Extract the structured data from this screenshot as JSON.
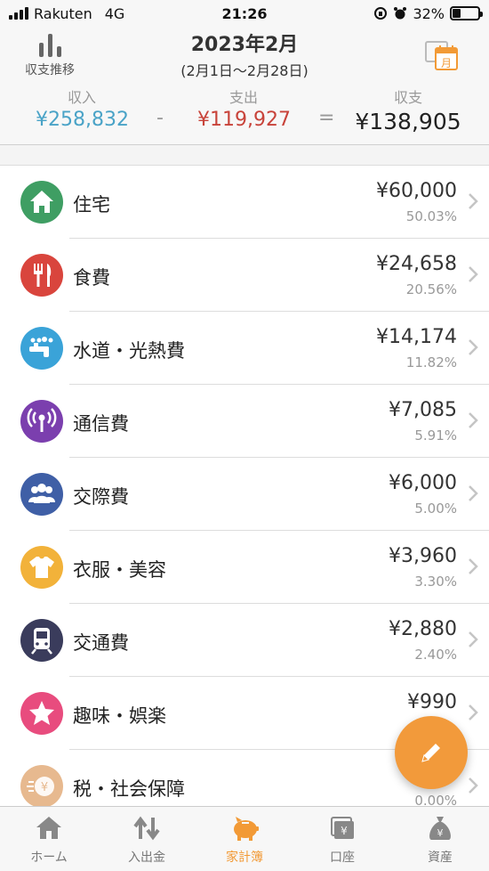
{
  "status": {
    "carrier": "Rakuten",
    "network": "4G",
    "time": "21:26",
    "battery": "32%"
  },
  "header": {
    "trend_label": "収支推移",
    "month_title": "2023年2月",
    "date_range": "(2月1日〜2月28日)",
    "calendar_badge": "月"
  },
  "summary": {
    "income_label": "収入",
    "income_value": "¥258,832",
    "expense_label": "支出",
    "expense_value": "¥119,927",
    "balance_label": "収支",
    "balance_value": "¥138,905",
    "minus": "-",
    "equals": "=",
    "colors": {
      "income": "#4aa3c7",
      "expense": "#c8433a"
    }
  },
  "categories": [
    {
      "name": "住宅",
      "amount": "¥60,000",
      "percent": "50.03%",
      "color": "#3f9e63",
      "icon": "house-icon"
    },
    {
      "name": "食費",
      "amount": "¥24,658",
      "percent": "20.56%",
      "color": "#d9453d",
      "icon": "fork-knife-icon"
    },
    {
      "name": "水道・光熱費",
      "amount": "¥14,174",
      "percent": "11.82%",
      "color": "#3aa3d8",
      "icon": "faucet-icon"
    },
    {
      "name": "通信費",
      "amount": "¥7,085",
      "percent": "5.91%",
      "color": "#7b3fae",
      "icon": "antenna-icon"
    },
    {
      "name": "交際費",
      "amount": "¥6,000",
      "percent": "5.00%",
      "color": "#3f5fa6",
      "icon": "people-icon"
    },
    {
      "name": "衣服・美容",
      "amount": "¥3,960",
      "percent": "3.30%",
      "color": "#f2b23a",
      "icon": "tshirt-icon"
    },
    {
      "name": "交通費",
      "amount": "¥2,880",
      "percent": "2.40%",
      "color": "#3a3c5c",
      "icon": "train-icon"
    },
    {
      "name": "趣味・娯楽",
      "amount": "¥990",
      "percent": "",
      "color": "#e84c7e",
      "icon": "star-icon"
    },
    {
      "name": "税・社会保障",
      "amount": "",
      "percent": "0.00%",
      "color": "#e7b98f",
      "icon": "coin-icon"
    }
  ],
  "tabs": [
    {
      "label": "ホーム",
      "icon": "home-icon",
      "active": false
    },
    {
      "label": "入出金",
      "icon": "transfer-icon",
      "active": false
    },
    {
      "label": "家計簿",
      "icon": "piggy-bank-icon",
      "active": true
    },
    {
      "label": "口座",
      "icon": "wallet-icon",
      "active": false
    },
    {
      "label": "資産",
      "icon": "money-bag-icon",
      "active": false
    }
  ]
}
